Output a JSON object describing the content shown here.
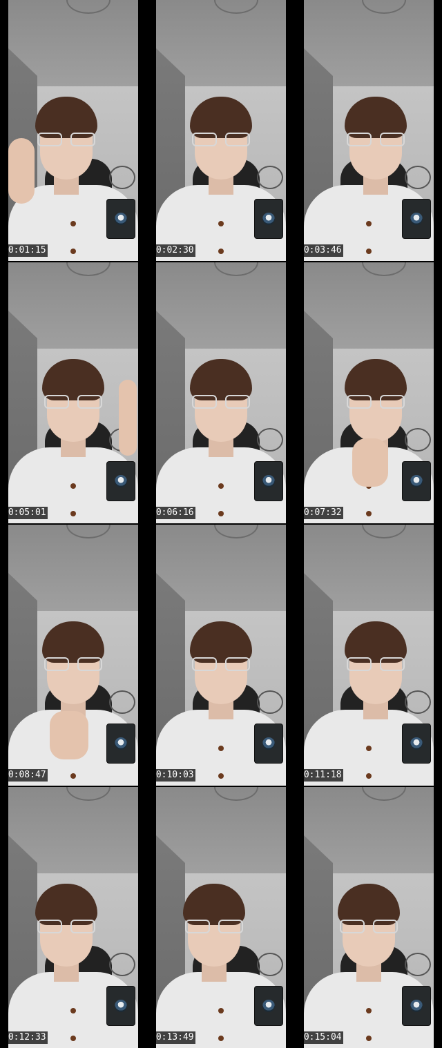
{
  "frames": [
    {
      "timestamp": "00:01:15"
    },
    {
      "timestamp": "00:02:30"
    },
    {
      "timestamp": "00:03:46"
    },
    {
      "timestamp": "00:05:01"
    },
    {
      "timestamp": "00:06:16"
    },
    {
      "timestamp": "00:07:32"
    },
    {
      "timestamp": "00:08:47"
    },
    {
      "timestamp": "00:10:03"
    },
    {
      "timestamp": "00:11:18"
    },
    {
      "timestamp": "00:12:33"
    },
    {
      "timestamp": "00:13:49"
    },
    {
      "timestamp": "00:15:04"
    }
  ],
  "colors": {
    "background": "#000000",
    "wall": "#c4c4c4",
    "hair": "#4a2f22",
    "shirt": "#e9e9e9",
    "badge": "#262a2c"
  },
  "icons": {
    "badge": "profile-avatar-icon"
  }
}
